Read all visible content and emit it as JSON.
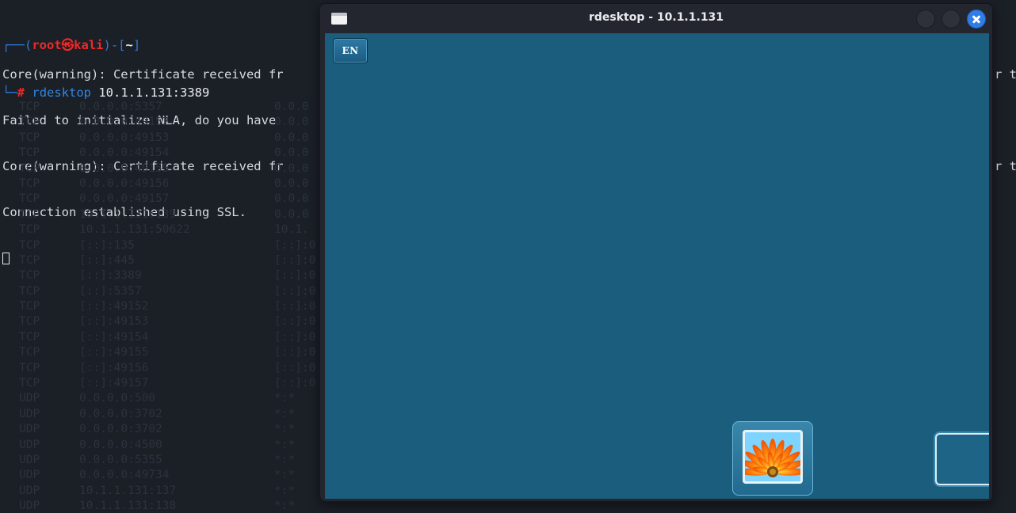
{
  "terminal": {
    "prompt": {
      "user_host": "root㉿kali",
      "dir": "~",
      "command": "rdesktop",
      "args": " 10.1.1.131:3389"
    },
    "output_lines": [
      "Core(warning): Certificate received fr",
      "Failed to initialize NLA, do you have",
      "Core(warning): Certificate received fr",
      "Connection established using SSL."
    ],
    "overflow_right": [
      "r t",
      "",
      "r t"
    ],
    "faded_rows": [
      [
        "TCP",
        "0.0.0.0:5357",
        "0.0.0"
      ],
      [
        "TCP",
        "0.0.0.0:49152",
        "0.0.0"
      ],
      [
        "TCP",
        "0.0.0.0:49153",
        "0.0.0"
      ],
      [
        "TCP",
        "0.0.0.0:49154",
        "0.0.0"
      ],
      [
        "TCP",
        "0.0.0.0:49155",
        "0.0.0"
      ],
      [
        "TCP",
        "0.0.0.0:49156",
        "0.0.0"
      ],
      [
        "TCP",
        "0.0.0.0:49157",
        "0.0.0"
      ],
      [
        "TCP",
        "10.1.1.131:139",
        "0.0.0"
      ],
      [
        "TCP",
        "10.1.1.131:50622",
        "10.1."
      ],
      [
        "TCP",
        "[::]:135",
        "[::]:0"
      ],
      [
        "TCP",
        "[::]:445",
        "[::]:0"
      ],
      [
        "TCP",
        "[::]:3389",
        "[::]:0"
      ],
      [
        "TCP",
        "[::]:5357",
        "[::]:0"
      ],
      [
        "TCP",
        "[::]:49152",
        "[::]:0"
      ],
      [
        "TCP",
        "[::]:49153",
        "[::]:0"
      ],
      [
        "TCP",
        "[::]:49154",
        "[::]:0"
      ],
      [
        "TCP",
        "[::]:49155",
        "[::]:0"
      ],
      [
        "TCP",
        "[::]:49156",
        "[::]:0"
      ],
      [
        "TCP",
        "[::]:49157",
        "[::]:0"
      ],
      [
        "UDP",
        "0.0.0.0:500",
        "*:*"
      ],
      [
        "UDP",
        "0.0.0.0:3702",
        "*:*"
      ],
      [
        "UDP",
        "0.0.0.0:3702",
        "*:*"
      ],
      [
        "UDP",
        "0.0.0.0:4500",
        "*:*"
      ],
      [
        "UDP",
        "0.0.0.0:5355",
        "*:*"
      ],
      [
        "UDP",
        "0.0.0.0:49734",
        "*:*"
      ],
      [
        "UDP",
        "10.1.1.131:137",
        "*:*"
      ],
      [
        "UDP",
        "10.1.1.131:138",
        "*:*"
      ]
    ]
  },
  "window": {
    "title": "rdesktop - 10.1.1.131",
    "icon": "window-icon",
    "buttons": [
      "minimize",
      "maximize",
      "close"
    ],
    "close_color": "#2f7de6"
  },
  "remote": {
    "background": "#1b5d7c",
    "language_button": "EN",
    "user_tile_picture": "flower-picture",
    "second_tile": "blank-user-tile"
  }
}
